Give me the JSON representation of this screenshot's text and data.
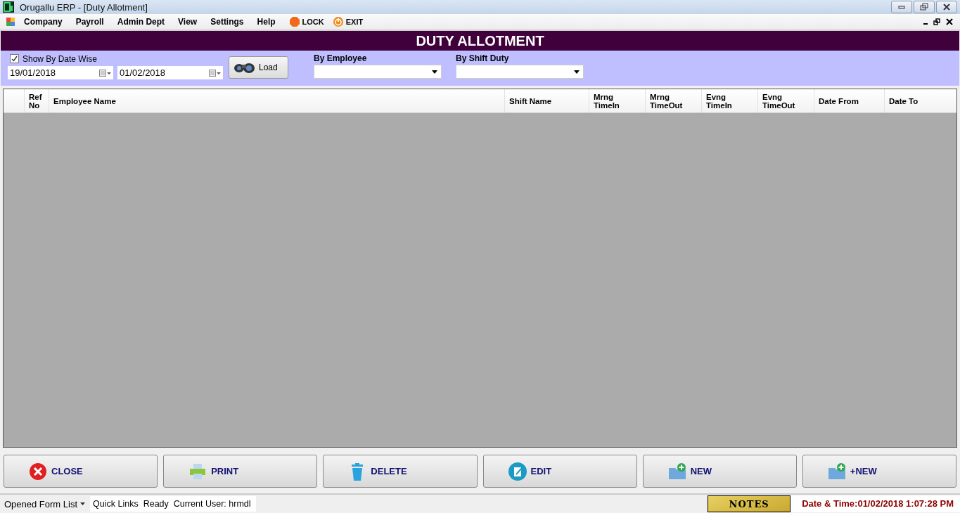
{
  "window": {
    "title": "Orugallu ERP - [Duty Allotment]"
  },
  "menu": [
    {
      "kind": "app"
    },
    {
      "kind": "text",
      "label": "Company"
    },
    {
      "kind": "text",
      "label": "Payroll"
    },
    {
      "kind": "text",
      "label": "Admin Dept"
    },
    {
      "kind": "text",
      "label": "View"
    },
    {
      "kind": "text",
      "label": "Settings"
    },
    {
      "kind": "text",
      "label": "Help"
    },
    {
      "kind": "lock",
      "label": "LOCK"
    },
    {
      "kind": "exit",
      "label": "EXIT"
    }
  ],
  "form_title": "DUTY ALLOTMENT",
  "filters": {
    "date_wise": {
      "label": "Show By Date Wise",
      "checked": true
    },
    "date_from": "19/01/2018",
    "date_to": "01/02/2018",
    "load_button": "Load",
    "by_employee": {
      "label": "By Employee"
    },
    "by_shift": {
      "label": "By Shift Duty"
    }
  },
  "table": {
    "columns": [
      [
        "Ref",
        "No"
      ],
      [
        "Employee Name"
      ],
      [
        "Shift Name"
      ],
      [
        "Mrng",
        "TimeIn"
      ],
      [
        "Mrng",
        "TimeOut"
      ],
      [
        "Evng",
        "TimeIn"
      ],
      [
        "Evng",
        "TimeOut"
      ],
      [
        "Date From"
      ],
      [
        "Date To"
      ]
    ]
  },
  "buttons": [
    {
      "kind": "close",
      "label": "CLOSE"
    },
    {
      "kind": "print",
      "label": "PRINT"
    },
    {
      "kind": "delete",
      "label": "DELETE"
    },
    {
      "kind": "edit",
      "label": "EDIT"
    },
    {
      "kind": "new",
      "label": "NEW"
    },
    {
      "kind": "new",
      "label": "+NEW"
    }
  ],
  "status_bar": {
    "opened_forms": "Opened Form List",
    "quick_links": "Quick Links",
    "status": "Ready",
    "user": "Current User: hrmdl",
    "notes": "NOTES",
    "datetime": "Date & Time:01/02/2018 1:07:28 PM"
  }
}
